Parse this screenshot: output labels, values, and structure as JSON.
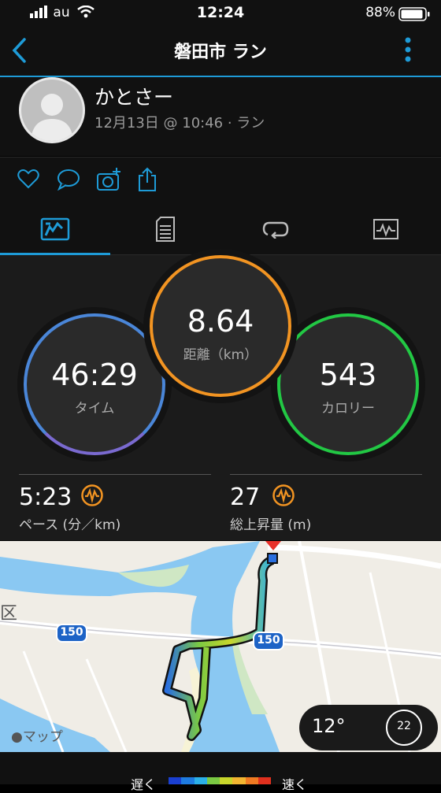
{
  "status_bar": {
    "carrier": "au",
    "time": "12:24",
    "battery": "88%"
  },
  "nav": {
    "title": "磐田市 ラン",
    "back_icon": "chevron-left-icon",
    "menu_icon": "more-vertical-icon",
    "accent": "#1e9bd7"
  },
  "profile": {
    "name": "かとさー",
    "subtitle": "12月13日 @ 10:46 · ラン"
  },
  "actions": [
    "heart-icon",
    "comment-icon",
    "camera-add-icon",
    "share-icon"
  ],
  "tabs": [
    {
      "icon": "summary-icon",
      "active": true
    },
    {
      "icon": "details-icon",
      "active": false
    },
    {
      "icon": "laps-icon",
      "active": false
    },
    {
      "icon": "chart-icon",
      "active": false
    }
  ],
  "stats": {
    "time": {
      "value": "46:29",
      "label": "タイム"
    },
    "distance": {
      "value": "8.64",
      "label": "距離（km）"
    },
    "calories": {
      "value": "543",
      "label": "カロリー"
    }
  },
  "metrics": {
    "pace": {
      "value": "5:23",
      "label": "ペース (分／km)"
    },
    "ascent": {
      "value": "27",
      "label": "総上昇量 (m)"
    }
  },
  "map": {
    "road_label_1": "150",
    "road_label_2": "150",
    "maps_credit": "マップ",
    "temperature": "12°",
    "wind": "22",
    "edge_label": "区"
  },
  "legend": {
    "slow": "遅く",
    "fast": "速く",
    "colors": [
      "#1a3fd1",
      "#1e7be0",
      "#2bb0e8",
      "#7ac943",
      "#c8d62b",
      "#f2b531",
      "#f07a22",
      "#e0301e"
    ]
  }
}
